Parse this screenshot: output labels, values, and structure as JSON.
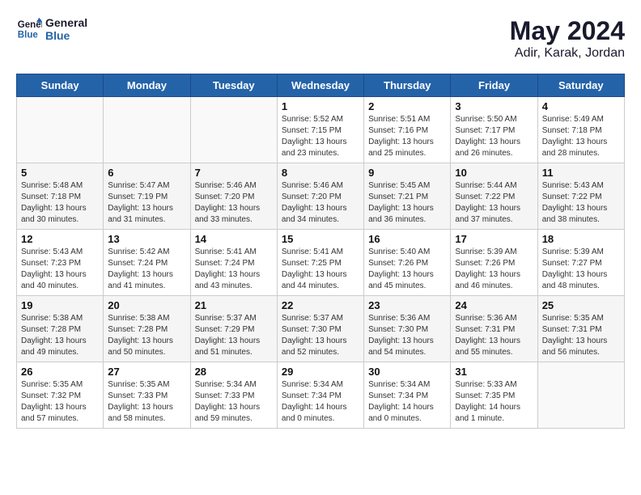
{
  "header": {
    "logo_line1": "General",
    "logo_line2": "Blue",
    "month": "May 2024",
    "location": "Adir, Karak, Jordan"
  },
  "weekdays": [
    "Sunday",
    "Monday",
    "Tuesday",
    "Wednesday",
    "Thursday",
    "Friday",
    "Saturday"
  ],
  "weeks": [
    [
      {
        "day": "",
        "info": ""
      },
      {
        "day": "",
        "info": ""
      },
      {
        "day": "",
        "info": ""
      },
      {
        "day": "1",
        "info": "Sunrise: 5:52 AM\nSunset: 7:15 PM\nDaylight: 13 hours\nand 23 minutes."
      },
      {
        "day": "2",
        "info": "Sunrise: 5:51 AM\nSunset: 7:16 PM\nDaylight: 13 hours\nand 25 minutes."
      },
      {
        "day": "3",
        "info": "Sunrise: 5:50 AM\nSunset: 7:17 PM\nDaylight: 13 hours\nand 26 minutes."
      },
      {
        "day": "4",
        "info": "Sunrise: 5:49 AM\nSunset: 7:18 PM\nDaylight: 13 hours\nand 28 minutes."
      }
    ],
    [
      {
        "day": "5",
        "info": "Sunrise: 5:48 AM\nSunset: 7:18 PM\nDaylight: 13 hours\nand 30 minutes."
      },
      {
        "day": "6",
        "info": "Sunrise: 5:47 AM\nSunset: 7:19 PM\nDaylight: 13 hours\nand 31 minutes."
      },
      {
        "day": "7",
        "info": "Sunrise: 5:46 AM\nSunset: 7:20 PM\nDaylight: 13 hours\nand 33 minutes."
      },
      {
        "day": "8",
        "info": "Sunrise: 5:46 AM\nSunset: 7:20 PM\nDaylight: 13 hours\nand 34 minutes."
      },
      {
        "day": "9",
        "info": "Sunrise: 5:45 AM\nSunset: 7:21 PM\nDaylight: 13 hours\nand 36 minutes."
      },
      {
        "day": "10",
        "info": "Sunrise: 5:44 AM\nSunset: 7:22 PM\nDaylight: 13 hours\nand 37 minutes."
      },
      {
        "day": "11",
        "info": "Sunrise: 5:43 AM\nSunset: 7:22 PM\nDaylight: 13 hours\nand 38 minutes."
      }
    ],
    [
      {
        "day": "12",
        "info": "Sunrise: 5:43 AM\nSunset: 7:23 PM\nDaylight: 13 hours\nand 40 minutes."
      },
      {
        "day": "13",
        "info": "Sunrise: 5:42 AM\nSunset: 7:24 PM\nDaylight: 13 hours\nand 41 minutes."
      },
      {
        "day": "14",
        "info": "Sunrise: 5:41 AM\nSunset: 7:24 PM\nDaylight: 13 hours\nand 43 minutes."
      },
      {
        "day": "15",
        "info": "Sunrise: 5:41 AM\nSunset: 7:25 PM\nDaylight: 13 hours\nand 44 minutes."
      },
      {
        "day": "16",
        "info": "Sunrise: 5:40 AM\nSunset: 7:26 PM\nDaylight: 13 hours\nand 45 minutes."
      },
      {
        "day": "17",
        "info": "Sunrise: 5:39 AM\nSunset: 7:26 PM\nDaylight: 13 hours\nand 46 minutes."
      },
      {
        "day": "18",
        "info": "Sunrise: 5:39 AM\nSunset: 7:27 PM\nDaylight: 13 hours\nand 48 minutes."
      }
    ],
    [
      {
        "day": "19",
        "info": "Sunrise: 5:38 AM\nSunset: 7:28 PM\nDaylight: 13 hours\nand 49 minutes."
      },
      {
        "day": "20",
        "info": "Sunrise: 5:38 AM\nSunset: 7:28 PM\nDaylight: 13 hours\nand 50 minutes."
      },
      {
        "day": "21",
        "info": "Sunrise: 5:37 AM\nSunset: 7:29 PM\nDaylight: 13 hours\nand 51 minutes."
      },
      {
        "day": "22",
        "info": "Sunrise: 5:37 AM\nSunset: 7:30 PM\nDaylight: 13 hours\nand 52 minutes."
      },
      {
        "day": "23",
        "info": "Sunrise: 5:36 AM\nSunset: 7:30 PM\nDaylight: 13 hours\nand 54 minutes."
      },
      {
        "day": "24",
        "info": "Sunrise: 5:36 AM\nSunset: 7:31 PM\nDaylight: 13 hours\nand 55 minutes."
      },
      {
        "day": "25",
        "info": "Sunrise: 5:35 AM\nSunset: 7:31 PM\nDaylight: 13 hours\nand 56 minutes."
      }
    ],
    [
      {
        "day": "26",
        "info": "Sunrise: 5:35 AM\nSunset: 7:32 PM\nDaylight: 13 hours\nand 57 minutes."
      },
      {
        "day": "27",
        "info": "Sunrise: 5:35 AM\nSunset: 7:33 PM\nDaylight: 13 hours\nand 58 minutes."
      },
      {
        "day": "28",
        "info": "Sunrise: 5:34 AM\nSunset: 7:33 PM\nDaylight: 13 hours\nand 59 minutes."
      },
      {
        "day": "29",
        "info": "Sunrise: 5:34 AM\nSunset: 7:34 PM\nDaylight: 14 hours\nand 0 minutes."
      },
      {
        "day": "30",
        "info": "Sunrise: 5:34 AM\nSunset: 7:34 PM\nDaylight: 14 hours\nand 0 minutes."
      },
      {
        "day": "31",
        "info": "Sunrise: 5:33 AM\nSunset: 7:35 PM\nDaylight: 14 hours\nand 1 minute."
      },
      {
        "day": "",
        "info": ""
      }
    ]
  ]
}
